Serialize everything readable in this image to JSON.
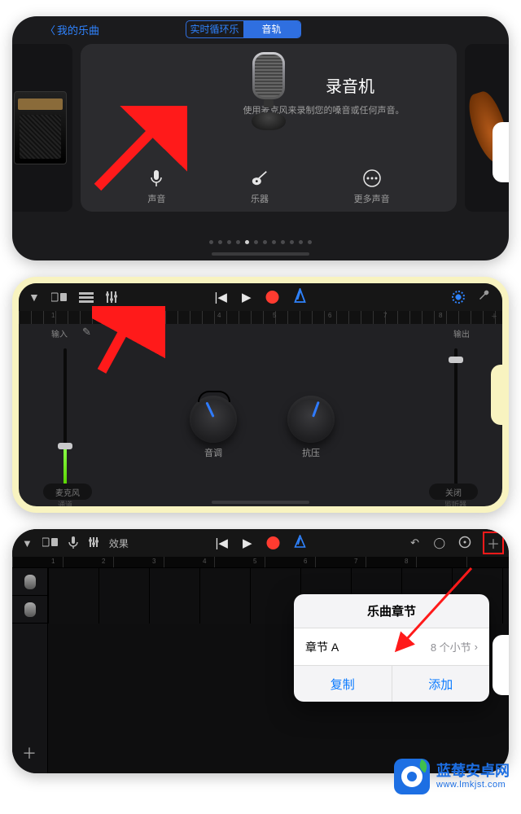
{
  "s1": {
    "back": "我的乐曲",
    "seg": {
      "left": "实时循环乐段",
      "right": "音轨"
    },
    "title": "录音机",
    "subtitle": "使用麦克风来录制您的嗓音或任何声音。",
    "opts": {
      "voice": "声音",
      "instrument": "乐器",
      "more": "更多声音"
    }
  },
  "s2": {
    "in": "输入",
    "out": "输出",
    "k1": "音调",
    "k2": "抗压",
    "pillL": "麦克风",
    "pillR": "关闭",
    "subL": "通道",
    "subR": "监听器"
  },
  "s3": {
    "fx": "效果",
    "pop": {
      "title": "乐曲章节",
      "row_label": "章节 A",
      "row_value": "8 个小节",
      "dup": "复制",
      "add": "添加"
    }
  },
  "wm": {
    "name": "蓝莓安卓网",
    "url": "www.lmkjst.com"
  }
}
